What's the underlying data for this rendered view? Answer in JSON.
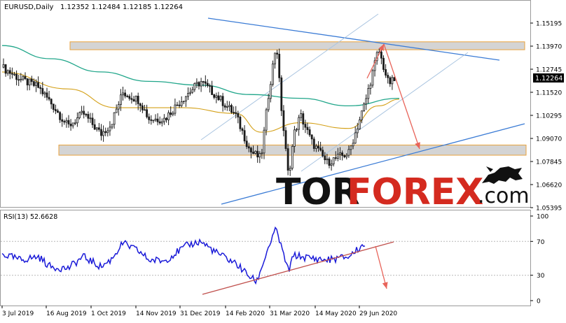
{
  "header": {
    "symbol": "EURUSD,Daily",
    "ohlc": "1.12352 1.12484 1.12185 1.12264"
  },
  "rsi_header": "RSI(13) 52.6628",
  "brand": {
    "tor": "TOR",
    "forex": "FOREX",
    "com": ".com"
  },
  "colors": {
    "candle": "#1a1a1a",
    "ma_fast": "#d4a017",
    "ma_slow": "#20a68a",
    "rsi_line": "#1a1ad8",
    "trend_blue": "#3a7bd5",
    "channel": "#a9c4e0",
    "zone_fill": "#d4d4d4",
    "zone_border": "#e8a23c",
    "arrow": "#e8645a",
    "rsi_trend": "#c0504d",
    "price_tag_bg": "#000000",
    "logo_dark": "#111111",
    "logo_red": "#d42a1f"
  },
  "chart_data": [
    {
      "type": "candlestick",
      "title": "EURUSD,Daily",
      "x_tick_labels": [
        "3 Jul 2019",
        "16 Aug 2019",
        "1 Oct 2019",
        "14 Nov 2019",
        "31 Dec 2019",
        "14 Feb 2020",
        "31 Mar 2020",
        "14 May 2020",
        "29 Jun 2020"
      ],
      "y_tick_labels": [
        "1.15195",
        "1.13970",
        "1.12745",
        "1.11520",
        "1.10295",
        "1.09070",
        "1.07845",
        "1.06620",
        "1.05395"
      ],
      "ylim": [
        1.05395,
        1.15195
      ],
      "current_price": "1.12264",
      "close_path": [
        [
          "2019-07-03",
          1.1285
        ],
        [
          "2019-07-20",
          1.122
        ],
        [
          "2019-08-05",
          1.118
        ],
        [
          "2019-08-16",
          1.11
        ],
        [
          "2019-09-01",
          1.097
        ],
        [
          "2019-09-15",
          1.104
        ],
        [
          "2019-10-01",
          1.093
        ],
        [
          "2019-10-10",
          1.098
        ],
        [
          "2019-10-21",
          1.115
        ],
        [
          "2019-11-05",
          1.111
        ],
        [
          "2019-11-14",
          1.101
        ],
        [
          "2019-11-28",
          1.101
        ],
        [
          "2019-12-10",
          1.109
        ],
        [
          "2019-12-20",
          1.115
        ],
        [
          "2019-12-31",
          1.121
        ],
        [
          "2020-01-15",
          1.113
        ],
        [
          "2020-02-01",
          1.103
        ],
        [
          "2020-02-14",
          1.084
        ],
        [
          "2020-02-24",
          1.08
        ],
        [
          "2020-03-02",
          1.115
        ],
        [
          "2020-03-09",
          1.142
        ],
        [
          "2020-03-13",
          1.11
        ],
        [
          "2020-03-20",
          1.07
        ],
        [
          "2020-03-25",
          1.093
        ],
        [
          "2020-03-31",
          1.103
        ],
        [
          "2020-04-10",
          1.089
        ],
        [
          "2020-04-24",
          1.078
        ],
        [
          "2020-05-14",
          1.083
        ],
        [
          "2020-05-29",
          1.11
        ],
        [
          "2020-06-10",
          1.138
        ],
        [
          "2020-06-19",
          1.12
        ],
        [
          "2020-06-29",
          1.1226
        ]
      ],
      "ma_fast_path": [
        [
          "2019-07-03",
          1.126
        ],
        [
          "2019-09-01",
          1.117
        ],
        [
          "2019-10-15",
          1.107
        ],
        [
          "2019-12-15",
          1.107
        ],
        [
          "2020-02-01",
          1.104
        ],
        [
          "2020-02-24",
          1.094
        ],
        [
          "2020-03-31",
          1.099
        ],
        [
          "2020-05-14",
          1.096
        ],
        [
          "2020-06-10",
          1.108
        ],
        [
          "2020-06-29",
          1.1115
        ]
      ],
      "ma_slow_path": [
        [
          "2019-07-03",
          1.14
        ],
        [
          "2019-08-16",
          1.133
        ],
        [
          "2019-10-01",
          1.126
        ],
        [
          "2019-11-14",
          1.121
        ],
        [
          "2019-12-31",
          1.119
        ],
        [
          "2020-02-14",
          1.114
        ],
        [
          "2020-03-31",
          1.112
        ],
        [
          "2020-05-14",
          1.108
        ],
        [
          "2020-06-29",
          1.112
        ]
      ],
      "zones": [
        {
          "from": 1.1378,
          "to": 1.142
        },
        {
          "from": 1.0818,
          "to": 1.0872
        }
      ]
    },
    {
      "type": "line",
      "title": "RSI(13) 52.6628",
      "y_tick_labels": [
        "100",
        "70",
        "30",
        "0"
      ],
      "ylim": [
        0,
        100
      ],
      "series": [
        {
          "values": [
            [
              "2019-07-03",
              55
            ],
            [
              "2019-07-20",
              48
            ],
            [
              "2019-08-05",
              52
            ],
            [
              "2019-08-16",
              40
            ],
            [
              "2019-09-01",
              38
            ],
            [
              "2019-09-15",
              52
            ],
            [
              "2019-10-01",
              40
            ],
            [
              "2019-10-10",
              48
            ],
            [
              "2019-10-21",
              68
            ],
            [
              "2019-11-05",
              58
            ],
            [
              "2019-11-14",
              48
            ],
            [
              "2019-11-28",
              47
            ],
            [
              "2019-12-10",
              58
            ],
            [
              "2019-12-20",
              66
            ],
            [
              "2019-12-31",
              70
            ],
            [
              "2020-01-15",
              56
            ],
            [
              "2020-02-01",
              44
            ],
            [
              "2020-02-14",
              28
            ],
            [
              "2020-02-20",
              22
            ],
            [
              "2020-03-02",
              64
            ],
            [
              "2020-03-09",
              85
            ],
            [
              "2020-03-13",
              65
            ],
            [
              "2020-03-20",
              35
            ],
            [
              "2020-03-25",
              54
            ],
            [
              "2020-03-31",
              52
            ],
            [
              "2020-04-10",
              50
            ],
            [
              "2020-04-24",
              48
            ],
            [
              "2020-05-14",
              52
            ],
            [
              "2020-05-29",
              68
            ],
            [
              "2020-06-10",
              82
            ],
            [
              "2020-06-19",
              62
            ],
            [
              "2020-06-29",
              56
            ]
          ]
        }
      ]
    }
  ]
}
